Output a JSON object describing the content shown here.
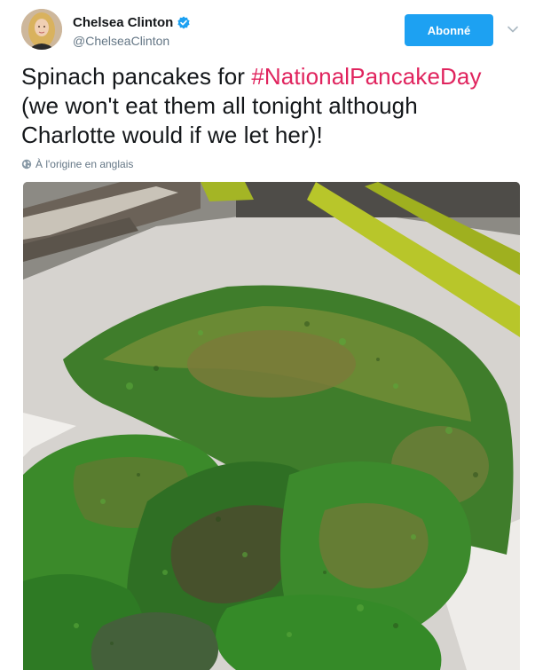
{
  "user": {
    "display_name": "Chelsea Clinton",
    "handle": "@ChelseaClinton",
    "verified": true
  },
  "follow_button": {
    "label": "Abonné"
  },
  "tweet": {
    "text_before": "Spinach pancakes for ",
    "hashtag": "#NationalPancakeDay",
    "text_after": " (we won't eat them all tonight although Charlotte would if we let her)!"
  },
  "translate": {
    "label": "À l'origine en anglais"
  },
  "colors": {
    "follow_button": "#1da1f2",
    "hashtag": "#e0245e",
    "verified_badge": "#1da1f2",
    "secondary_text": "#657786"
  },
  "icons": {
    "verified": "verified-badge-icon",
    "menu": "chevron-down-icon",
    "translate": "globe-icon"
  }
}
